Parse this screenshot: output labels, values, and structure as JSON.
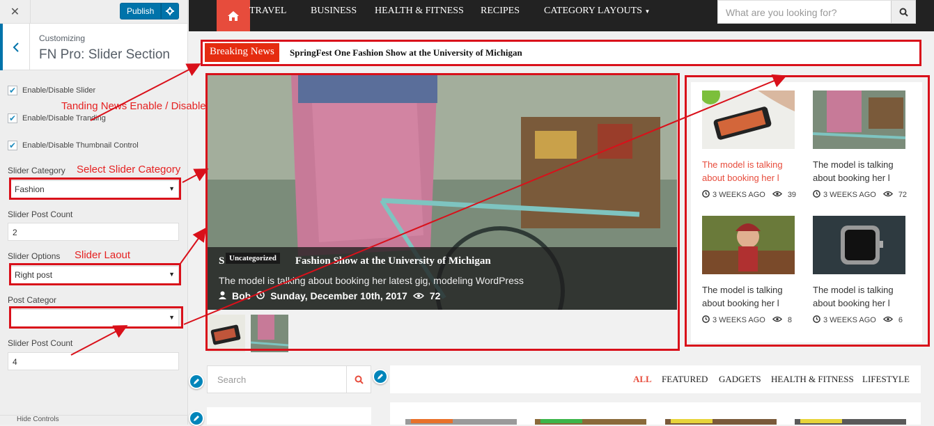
{
  "customizer": {
    "close_icon": "close-icon",
    "publish_label": "Publish",
    "breadcrumb": "Customizing",
    "section_title": "FN Pro: Slider Section",
    "checkboxes": [
      {
        "label": "Enable/Disable Slider",
        "checked": true
      },
      {
        "label": "Enable/Disable Tranding",
        "checked": true
      },
      {
        "label": "Enable/Disable Thumbnail Control",
        "checked": true
      }
    ],
    "slider_category": {
      "label": "Slider Category",
      "value": "Fashion"
    },
    "slider_post_count": {
      "label": "Slider Post Count",
      "value": "2"
    },
    "slider_options": {
      "label": "Slider Options",
      "value": "Right post"
    },
    "post_category": {
      "label": "Post Categor",
      "value": ""
    },
    "slider_post_count_2": {
      "label": "Slider Post Count",
      "value": "4"
    },
    "footer_label": "Hide Controls"
  },
  "annotations": {
    "tanding": "Tanding News Enable / Disable",
    "select_category": "Select Slider Category",
    "slider_layout": "Slider Laout",
    "color": "#e52121"
  },
  "site": {
    "nav": {
      "items": [
        "TRAVEL",
        "BUSINESS",
        "HEALTH & FITNESS",
        "RECIPES",
        "CATEGORY LAYOUTS"
      ],
      "search_placeholder": "What are you looking for?"
    },
    "breaking": {
      "label": "Breaking News",
      "headline": "SpringFest One Fashion Show at the University of Michigan"
    },
    "slider": {
      "title_start": "S",
      "title_end": "Fashion Show at the University of Michigan",
      "category": "Uncategorized",
      "excerpt": "The model is talking about booking her latest gig, modeling WordPress",
      "author": "Bob",
      "date": "Sunday, December 10th, 2017",
      "views": "72"
    },
    "right_posts": [
      {
        "title": "The model is talking about booking her l",
        "time": "3 WEEKS AGO",
        "views": "39",
        "active": true
      },
      {
        "title": "The model is talking about booking her l",
        "time": "3 WEEKS AGO",
        "views": "72",
        "active": false
      },
      {
        "title": "The model is talking about booking her l",
        "time": "3 WEEKS AGO",
        "views": "8",
        "active": false
      },
      {
        "title": "The model is talking about booking her l",
        "time": "3 WEEKS AGO",
        "views": "6",
        "active": false
      }
    ],
    "search_placeholder": "Search",
    "filters": [
      "ALL",
      "FEATURED",
      "GADGETS",
      "HEALTH & FITNESS",
      "LIFESTYLE"
    ],
    "accent": "#e74c3c"
  }
}
